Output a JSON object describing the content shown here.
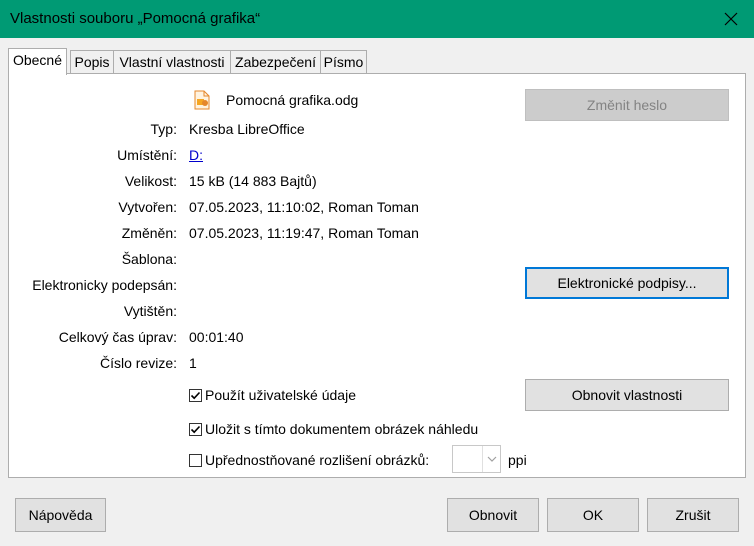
{
  "window": {
    "title": "Vlastnosti souboru „Pomocná grafika“"
  },
  "tabs": [
    {
      "label": "Obecné",
      "active": true
    },
    {
      "label": "Popis"
    },
    {
      "label": "Vlastní vlastnosti"
    },
    {
      "label": "Zabezpečení"
    },
    {
      "label": "Písmo"
    }
  ],
  "general": {
    "file_name": "Pomocná grafika.odg",
    "change_password_label": "Změnit heslo",
    "type_label": "Typ:",
    "type_value": "Kresba LibreOffice",
    "location_label": "Umístění:",
    "location_value": "D:",
    "size_label": "Velikost:",
    "size_value": "15 kB (14 883 Bajtů)",
    "created_label": "Vytvořen:",
    "created_value": "07.05.2023, 11:10:02, Roman Toman",
    "modified_label": "Změněn:",
    "modified_value": "07.05.2023, 11:19:47, Roman Toman",
    "template_label": "Šablona:",
    "signed_label": "Elektronicky podepsán:",
    "signatures_button": "Elektronické podpisy...",
    "printed_label": "Vytištěn:",
    "edit_time_label": "Celkový čas úprav:",
    "edit_time_value": "00:01:40",
    "revision_label": "Číslo revize:",
    "revision_value": "1",
    "use_user_data_label": "Použít uživatelské údaje",
    "use_user_data_checked": true,
    "reset_properties_button": "Obnovit vlastnosti",
    "save_thumbnail_label": "Uložit s tímto dokumentem obrázek náhledu",
    "save_thumbnail_checked": true,
    "preferred_resolution_label": "Upřednostňované rozlišení obrázků:",
    "preferred_resolution_checked": false,
    "resolution_value": "",
    "ppi_label": "ppi"
  },
  "footer": {
    "help_button": "Nápověda",
    "reset_button": "Obnovit",
    "ok_button": "OK",
    "cancel_button": "Zrušit"
  },
  "colors": {
    "titlebar": "#009a74",
    "accent": "#0078d7",
    "link": "#0000cc"
  },
  "icons": [
    "close-icon",
    "draw-document-icon",
    "check-icon",
    "chevron-down-icon"
  ]
}
